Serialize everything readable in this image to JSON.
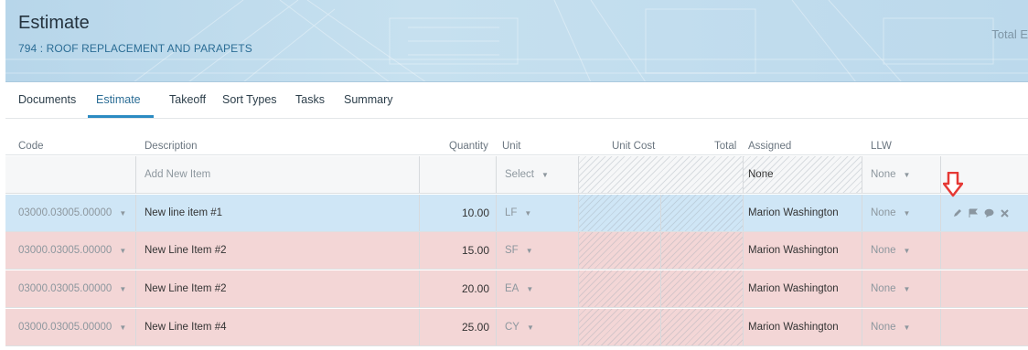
{
  "header": {
    "title": "Estimate",
    "subtitle": "794 : ROOF REPLACEMENT AND PARAPETS",
    "total_label": "Total E"
  },
  "tabs": [
    {
      "label": "Documents",
      "active": false
    },
    {
      "label": "Estimate",
      "active": true
    },
    {
      "label": "Takeoff",
      "active": false
    },
    {
      "label": "Sort Types",
      "active": false
    },
    {
      "label": "Tasks",
      "active": false
    },
    {
      "label": "Summary",
      "active": false
    }
  ],
  "columns": {
    "code": "Code",
    "description": "Description",
    "quantity": "Quantity",
    "unit": "Unit",
    "unit_cost": "Unit Cost",
    "total": "Total",
    "assigned": "Assigned",
    "llw": "LLW"
  },
  "add_row": {
    "description_placeholder": "Add New Item",
    "unit": "Select",
    "assigned": "None",
    "llw": "None"
  },
  "rows": [
    {
      "code": "03000.03005.00000",
      "description": "New line item #1",
      "quantity": "10.00",
      "unit": "LF",
      "assigned": "Marion Washington",
      "llw": "None",
      "state": "selected"
    },
    {
      "code": "03000.03005.00000",
      "description": "New Line Item #2",
      "quantity": "15.00",
      "unit": "SF",
      "assigned": "Marion Washington",
      "llw": "None",
      "state": "error"
    },
    {
      "code": "03000.03005.00000",
      "description": "New Line Item #2",
      "quantity": "20.00",
      "unit": "EA",
      "assigned": "Marion Washington",
      "llw": "None",
      "state": "error"
    },
    {
      "code": "03000.03005.00000",
      "description": "New Line Item #4",
      "quantity": "25.00",
      "unit": "CY",
      "assigned": "Marion Washington",
      "llw": "None",
      "state": "error"
    }
  ],
  "row_actions": [
    "pencil-icon",
    "flag-icon",
    "comment-icon",
    "close-icon"
  ],
  "colors": {
    "accent": "#2b8bc2",
    "selected_row": "#cfe6f6",
    "error_row": "#f3d6d6",
    "annotation_arrow": "#e53935"
  }
}
